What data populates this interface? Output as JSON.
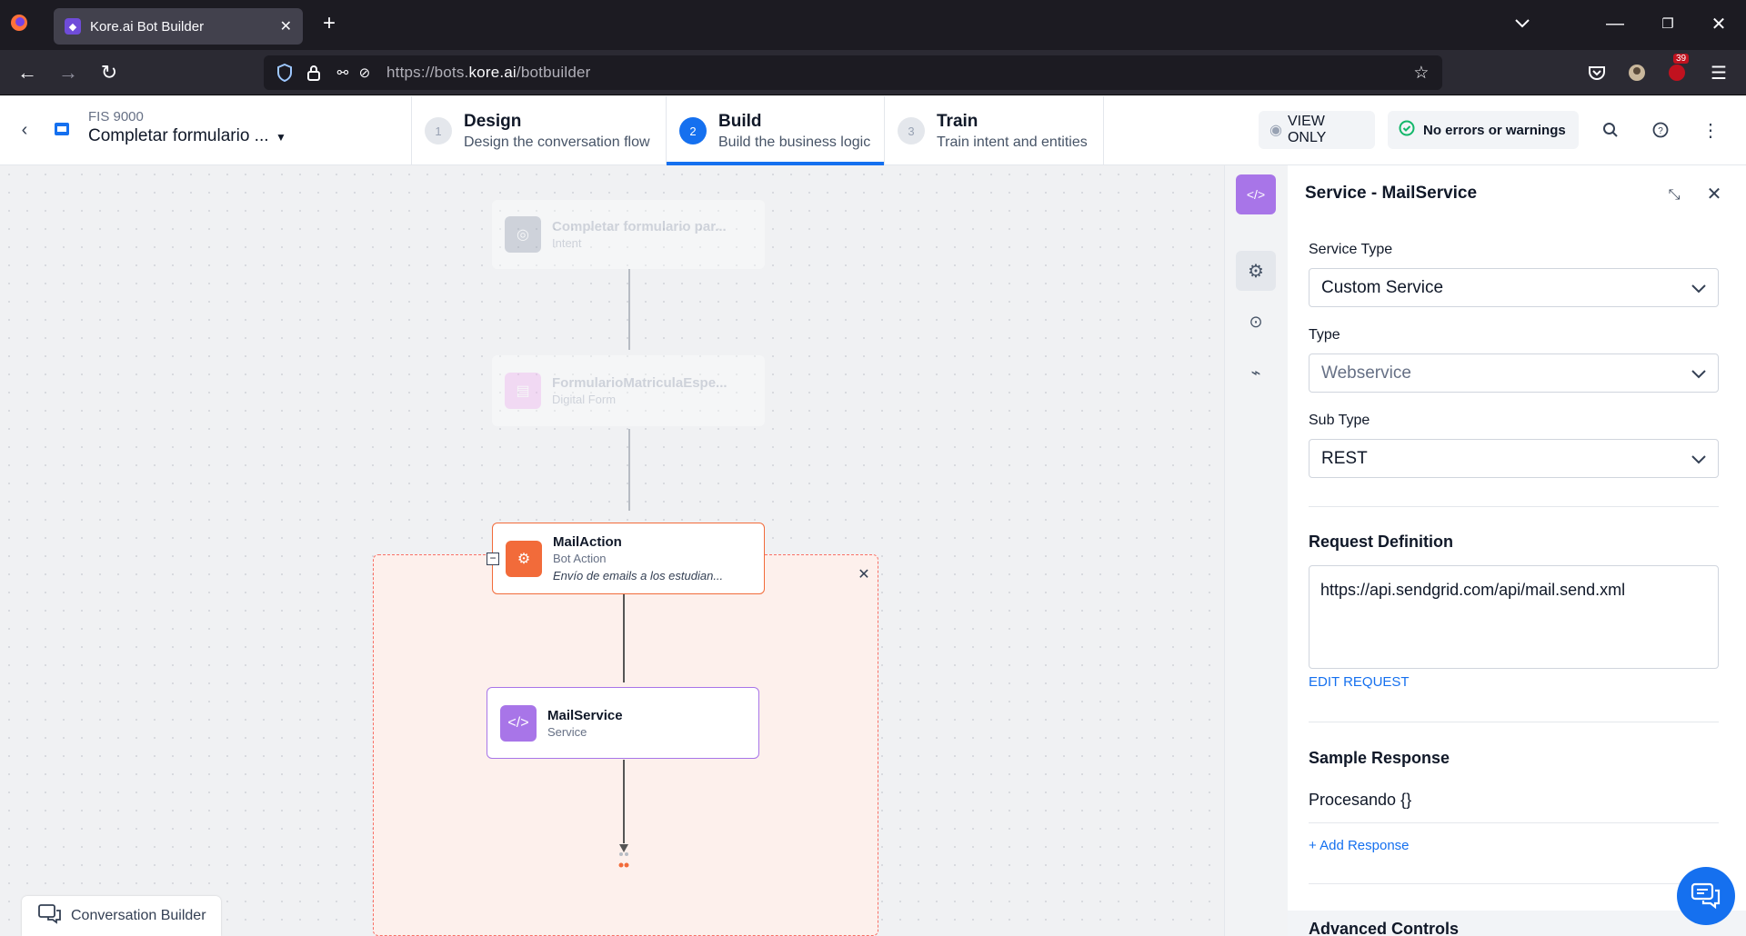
{
  "browser": {
    "tab_title": "Kore.ai Bot Builder",
    "url_prefix": "https://bots.",
    "url_domain": "kore.ai",
    "url_path": "/botbuilder",
    "badge_count": "39"
  },
  "header": {
    "bot_label": "FIS 9000",
    "task_name": "Completar formulario ...",
    "steps": [
      {
        "num": "1",
        "title": "Design",
        "subtitle": "Design the conversation flow"
      },
      {
        "num": "2",
        "title": "Build",
        "subtitle": "Build the business logic"
      },
      {
        "num": "3",
        "title": "Train",
        "subtitle": "Train intent and entities"
      }
    ],
    "view_only": "VIEW ONLY",
    "status": "No errors or warnings"
  },
  "canvas": {
    "nodes": [
      {
        "title": "Completar formulario par...",
        "subtitle": "Intent"
      },
      {
        "title": "FormularioMatriculaEspe...",
        "subtitle": "Digital Form"
      },
      {
        "title": "MailAction",
        "subtitle": "Bot Action",
        "description": "Envío de emails a los estudian..."
      },
      {
        "title": "MailService",
        "subtitle": "Service"
      }
    ],
    "conversation_builder": "Conversation Builder"
  },
  "panel": {
    "title": "Service - MailService",
    "service_type_label": "Service Type",
    "service_type_value": "Custom Service",
    "type_label": "Type",
    "type_value": "Webservice",
    "subtype_label": "Sub Type",
    "subtype_value": "REST",
    "request_definition_label": "Request Definition",
    "request_url": "https://api.sendgrid.com/api/mail.send.xml",
    "edit_request": "EDIT REQUEST",
    "sample_response_label": "Sample Response",
    "sample_response_value": "Procesando {}",
    "add_response": "+ Add Response",
    "advanced_controls": "Advanced Controls"
  },
  "colors": {
    "accent": "#1570ef",
    "bot_action": "#f26b3a",
    "service": "#a875e8",
    "group_border": "#f97066"
  }
}
